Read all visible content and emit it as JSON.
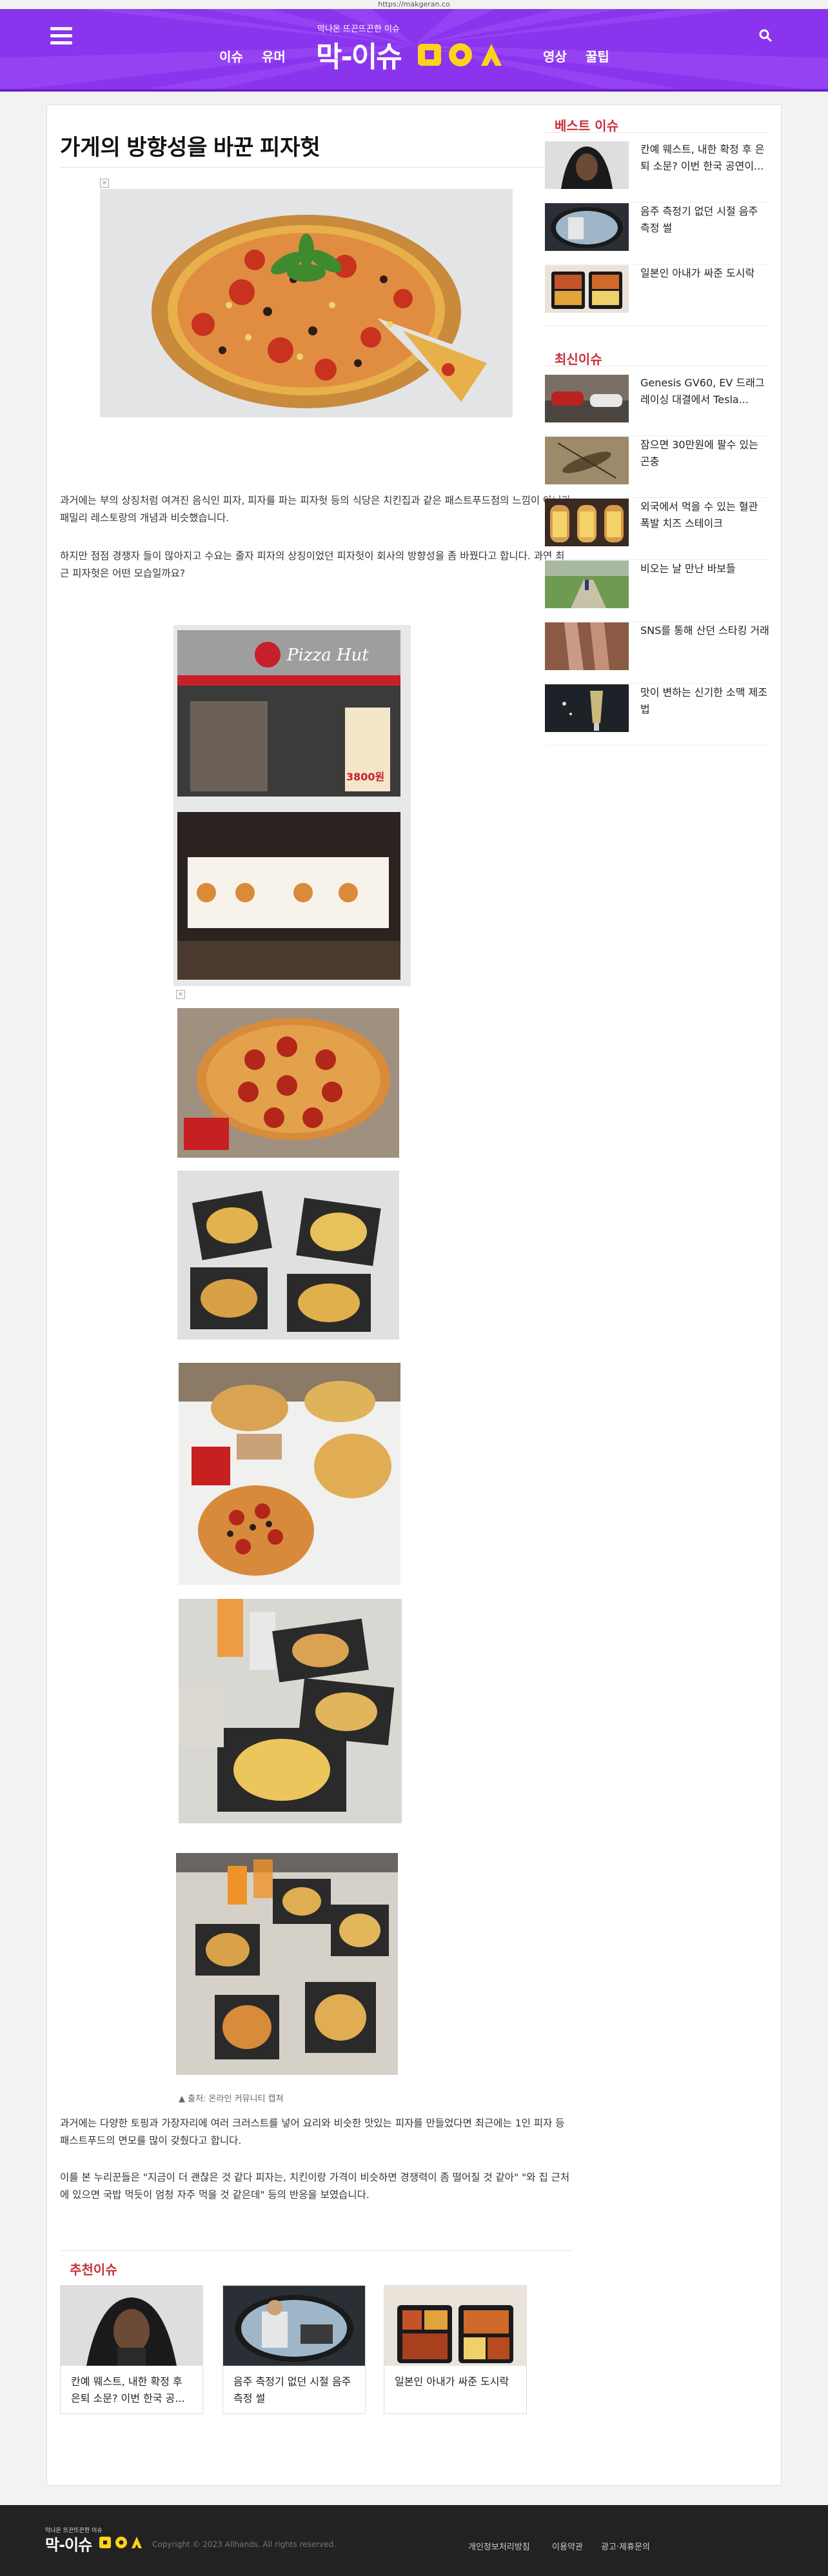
{
  "url": "https://makgeran.co",
  "header": {
    "tagline": "막나온 뜨끈뜨끈한 이슈",
    "logo": "막-이슈",
    "nav": [
      "이슈",
      "유머",
      "영상",
      "꿀팁"
    ],
    "accent": "#8a34ee"
  },
  "article": {
    "title": "가게의 방향성을 바꾼 피자헛",
    "para1": "과거에는 부의 상징처럼 여겨진 음식인 피자, 피자를 파는 피자헛 등의 식당은 치킨집과 같은 패스트푸드점의 느낌이 아니라 패밀리 레스토랑의 개념과 비슷했습니다.",
    "para2": "하지만 점점 경쟁자 들이 많아지고 수요는 줄자 피자의 상징이었던 피자헛이 회사의 방향성을 좀 바꿨다고 합니다. 과연 최근 피자헛은 어떤 모습일까요?",
    "store_sign": "Pizza Hut",
    "store_price": "3800원",
    "caption": "▲ 출처: 온라인 커뮤니티 캡쳐",
    "para3": "과거에는 다양한 토핑과 가장자리에 여러 크러스트를 넣어 요리와 비슷한 맛있는 피자를 만들었다면 최근에는 1인 피자 등 패스트푸드의 면모를 많이 갖췄다고 합니다.",
    "para4": "이를 본 누리꾼들은 \"지금이 더 괜찮은 것 같다 피자는, 치킨이랑 가격이 비슷하면 경쟁력이 좀 떨어질 것 같아\" \"와 집 근처에 있으면 국밥 먹듯이 엄청 자주 먹을 것 같은데\" 등의 반응을 보였습니다."
  },
  "recommended": {
    "title": "추천이슈",
    "items": [
      {
        "text": "칸예 웨스트, 내한 확정 후 은퇴 소문? 이번 한국 공..."
      },
      {
        "text": "음주 측정기 없던 시절 음주 측정 썰"
      },
      {
        "text": "일본인 아내가 싸준 도시락"
      }
    ]
  },
  "sidebar": {
    "best_title": "베스트 이슈",
    "best": [
      {
        "text": "칸예 웨스트, 내한 확정 후 은퇴 소문? 이번 한국 공연이..."
      },
      {
        "text": "음주 측정기 없던 시절 음주 측정 썰"
      },
      {
        "text": "일본인 아내가 싸준 도시락"
      }
    ],
    "latest_title": "최신이슈",
    "latest": [
      {
        "text": "Genesis GV60, EV 드래그 레이싱 대결에서 Tesla..."
      },
      {
        "text": "잠으면 30만원에 팔수 있는 곤충"
      },
      {
        "text": "외국에서 먹을 수 있는 혈관 폭발 치즈 스테이크"
      },
      {
        "text": "비오는 날 만난 바보들"
      },
      {
        "text": "SNS를 통해 산던 스타킹 거래"
      },
      {
        "text": "맛이 변하는 신기한 소맥 제조법"
      }
    ]
  },
  "footer": {
    "tagline": "막나온 뜨끈뜨끈한 이슈",
    "logo": "막-이슈",
    "copyright": "Copyright © 2023 Allhands. All rights reserved.",
    "links": [
      "개인정보처리방침",
      "이용약관",
      "광고·제휴문의"
    ]
  }
}
